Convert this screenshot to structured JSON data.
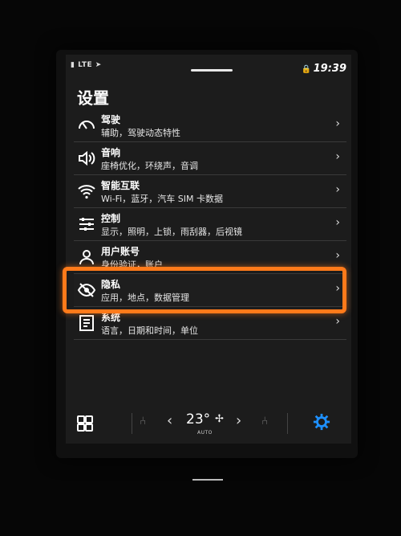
{
  "status": {
    "network": "LTE",
    "time": "19:39"
  },
  "page": {
    "title": "设置"
  },
  "menu": {
    "items": [
      {
        "title": "驾驶",
        "subtitle": "辅助，驾驶动态特性",
        "icon": "speedometer-icon"
      },
      {
        "title": "音响",
        "subtitle": "座椅优化，环绕声，音调",
        "icon": "speaker-icon"
      },
      {
        "title": "智能互联",
        "subtitle": "Wi-Fi，蓝牙，汽车 SIM 卡数据",
        "icon": "wifi-icon"
      },
      {
        "title": "控制",
        "subtitle": "显示，照明，上锁，雨刮器，后视镜",
        "icon": "sliders-icon"
      },
      {
        "title": "用户账号",
        "subtitle": "身份验证，账户",
        "icon": "user-icon"
      },
      {
        "title": "隐私",
        "subtitle": "应用，地点，数据管理",
        "icon": "privacy-eye-icon"
      },
      {
        "title": "系统",
        "subtitle": "语言，日期和时间，单位",
        "icon": "system-icon"
      }
    ]
  },
  "climate": {
    "temperature": "23°",
    "mode": "AUTO"
  },
  "colors": {
    "highlight": "#ff7a1a",
    "accent_blue": "#1e90ff"
  }
}
